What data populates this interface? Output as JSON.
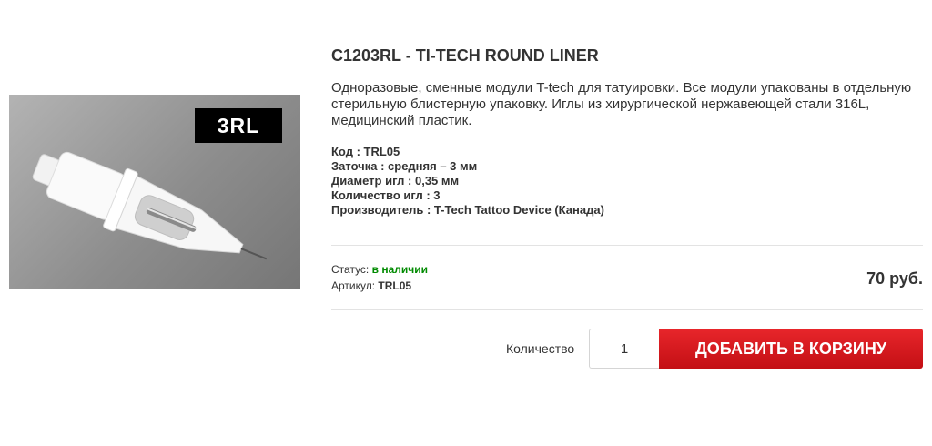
{
  "product": {
    "title": "C1203RL - TI-TECH ROUND LINER",
    "image_label": "3RL",
    "description": "Одноразовые, сменные модули T-tech для татуировки. Все модули упакованы в отдельную стерильную блистерную упаковку. Иглы из хирургической нержавеющей стали 316L, медицинский пластик.",
    "specs": [
      {
        "label": "Код : ",
        "value": "TRL05"
      },
      {
        "label": "Заточка : ",
        "value": "средняя – 3 мм"
      },
      {
        "label": "Диаметр игл : ",
        "value": "0,35 мм"
      },
      {
        "label": "Количество игл : ",
        "value": "3"
      },
      {
        "label": "Производитель : ",
        "value": "T-Tech Tattoo Device (Канада)"
      }
    ],
    "status_label": "Статус:",
    "status_value": "в наличии",
    "article_label": "Артикул:",
    "article_value": "TRL05",
    "price": "70 руб."
  },
  "cart": {
    "quantity_label": "Количество",
    "quantity_value": "1",
    "add_button_label": "ДОБАВИТЬ В КОРЗИНУ"
  },
  "colors": {
    "status_ok": "#008a00",
    "button_red": "#d7191e"
  }
}
